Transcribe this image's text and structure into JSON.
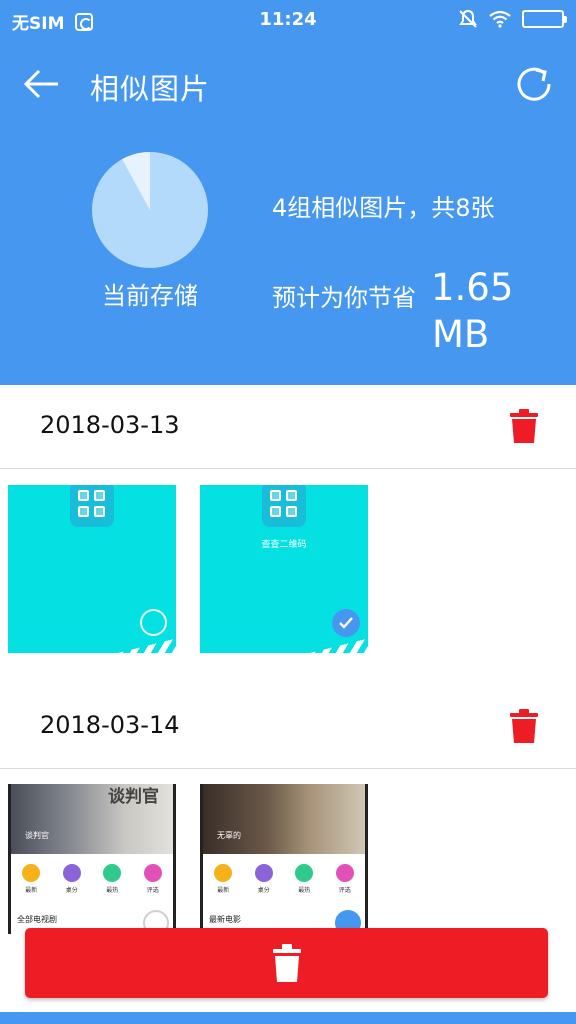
{
  "status_bar": {
    "carrier": "无SIM",
    "time": "11:24"
  },
  "toolbar": {
    "title": "相似图片",
    "back_icon": "arrow-left-icon",
    "refresh_icon": "refresh-icon"
  },
  "summary": {
    "storage_label": "当前存储",
    "groups_text": "4组相似图片，共8张",
    "saving_label": "预计为你节省",
    "saving_value": "1.65",
    "saving_unit": "MB",
    "pie_used_fraction": 0.08
  },
  "groups": [
    {
      "date": "2018-03-13",
      "images": [
        {
          "type": "qr",
          "caption": "",
          "selected": false
        },
        {
          "type": "qr",
          "caption": "查查二维码",
          "selected": true
        }
      ]
    },
    {
      "date": "2018-03-14",
      "images": [
        {
          "type": "photo",
          "overlay": "谈判官",
          "pic_text": "谈判官",
          "selected": false,
          "categories": [
            "最新",
            "桌分",
            "最热",
            "评选"
          ],
          "footer": "全部电视剧"
        },
        {
          "type": "photo",
          "overlay": "",
          "pic_text": "无辜的",
          "selected": true,
          "categories": [
            "最新",
            "桌分",
            "最热",
            "评选"
          ],
          "footer": "最新电影"
        }
      ]
    }
  ],
  "colors": {
    "primary": "#4597f0",
    "danger": "#ee1c24",
    "thumb_cyan": "#05e0e2",
    "pie_fill": "#b3d9fb",
    "category_dots": [
      "#f5b21b",
      "#8a64d8",
      "#2fc98c",
      "#e052b8"
    ]
  }
}
